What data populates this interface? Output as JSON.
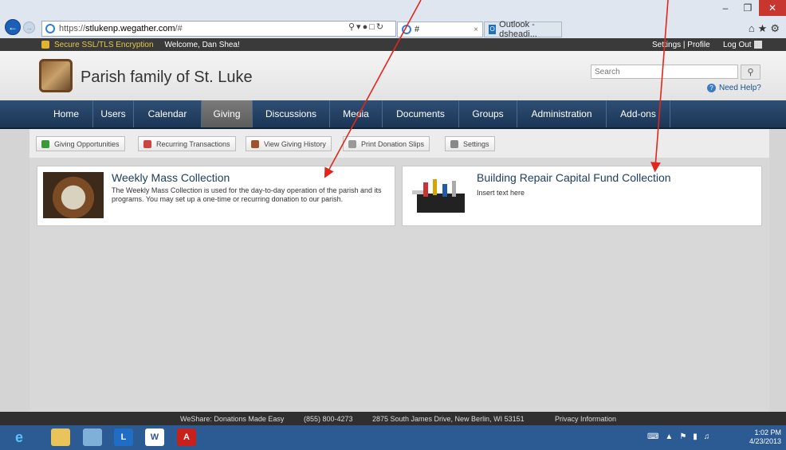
{
  "browser": {
    "url_prefix": "https://",
    "url_host": "stlukenp.wegather.com",
    "url_path": "/#",
    "tabs": [
      {
        "label": "#"
      },
      {
        "label": "Outlook - dsheadi..."
      }
    ],
    "window_controls": {
      "minimize": "–",
      "restore": "❐",
      "close": "✕"
    },
    "right_icons": "⌂★⚙"
  },
  "topbar": {
    "ssl_text": "Secure SSL/TLS Encryption",
    "welcome_text": "Welcome, Dan Shea!",
    "settings_profile": "Settings | Profile",
    "logout": "Log Out"
  },
  "header": {
    "site_title": "Parish family of St. Luke",
    "search_placeholder": "Search",
    "need_help": "Need Help?"
  },
  "mainnav": {
    "items": [
      {
        "label": "Home"
      },
      {
        "label": "Users"
      },
      {
        "label": "Calendar"
      },
      {
        "label": "Giving"
      },
      {
        "label": "Discussions"
      },
      {
        "label": "Media"
      },
      {
        "label": "Documents"
      },
      {
        "label": "Groups"
      },
      {
        "label": "Administration"
      },
      {
        "label": "Add-ons"
      }
    ]
  },
  "subnav": {
    "items": [
      {
        "label": "Giving Opportunities"
      },
      {
        "label": "Recurring Transactions"
      },
      {
        "label": "View Giving History"
      },
      {
        "label": "Print Donation Slips"
      },
      {
        "label": "Settings"
      }
    ]
  },
  "cards": [
    {
      "title": "Weekly Mass Collection",
      "description": "The Weekly Mass Collection is used for the day-to-day operation of the parish and its programs. You may set up a one-time or recurring donation to our parish."
    },
    {
      "title": "Building Repair Capital Fund Collection",
      "description": "Insert text here"
    }
  ],
  "footer": {
    "slogan": "WeShare: Donations Made Easy",
    "phone": "(855) 800-4273",
    "address": "2875 South James Drive, New Berlin, WI 53151",
    "privacy": "Privacy Information"
  },
  "taskbar": {
    "time": "1:02 PM",
    "date": "4/23/2013"
  },
  "colors": {
    "nav_bg": "#1b3555",
    "nav_active": "#666666",
    "accent_arrow": "#e3261b",
    "title_blue": "#1e3e63"
  }
}
